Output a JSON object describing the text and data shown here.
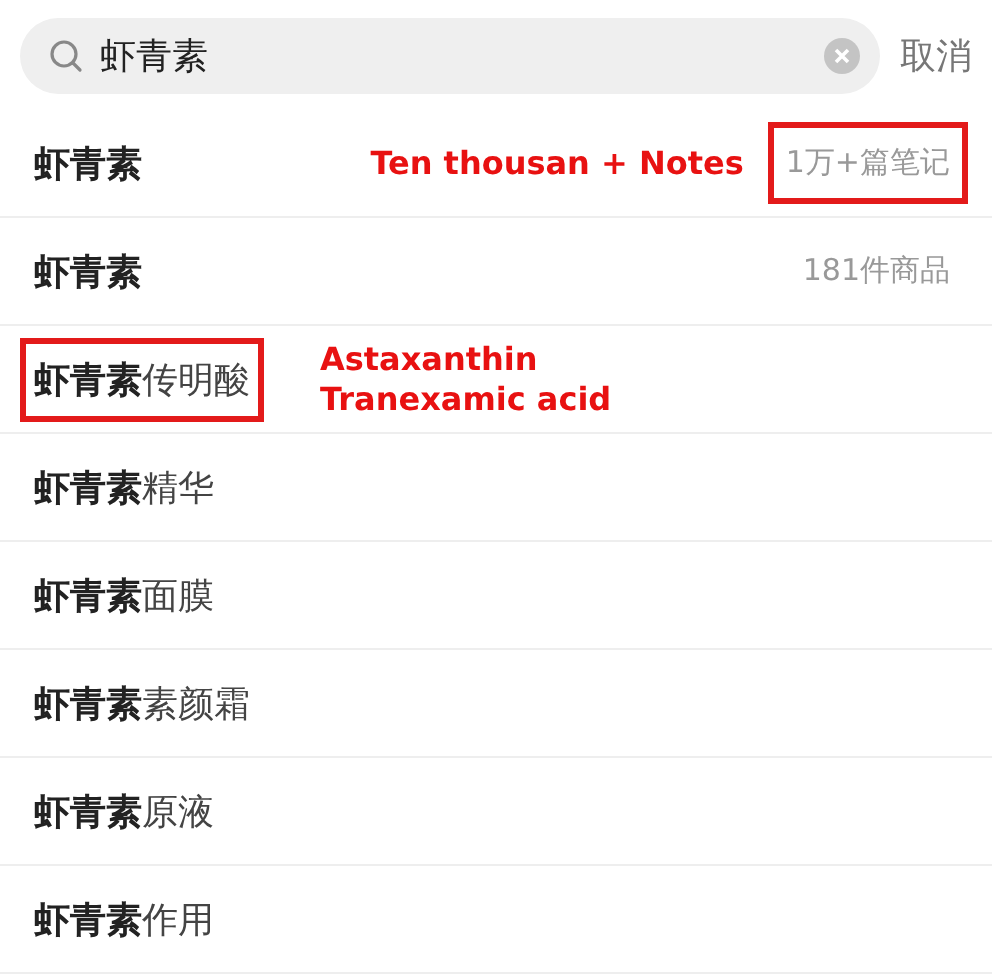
{
  "search": {
    "value": "虾青素",
    "cancel": "取消"
  },
  "suggestions": [
    {
      "match": "虾青素",
      "label_boxed": false,
      "trailing": {
        "text": "1万+篇笔记",
        "boxed": true
      },
      "note": [
        "Ten thousan + Notes"
      ]
    },
    {
      "match": "虾青素",
      "label_boxed": false,
      "trailing": {
        "text": "181件商品",
        "boxed": false
      }
    },
    {
      "match": "虾青素",
      "suffix": "传明酸",
      "label_boxed": true,
      "note": [
        "Astaxanthin",
        "Tranexamic acid"
      ]
    },
    {
      "match": "虾青素",
      "suffix": "精华",
      "label_boxed": false
    },
    {
      "match": "虾青素",
      "suffix": "面膜",
      "label_boxed": false
    },
    {
      "match": "虾青素",
      "suffix": "素颜霜",
      "label_boxed": false
    },
    {
      "match": "虾青素",
      "suffix": "原液",
      "label_boxed": false
    },
    {
      "match": "虾青素",
      "suffix": "作用",
      "label_boxed": false
    }
  ]
}
